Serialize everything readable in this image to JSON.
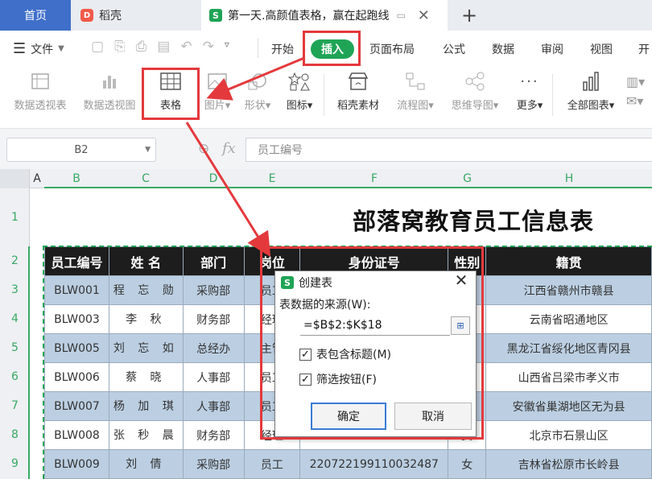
{
  "tabs": {
    "home": "首页",
    "wps": "稻壳",
    "doc": "第一天.高颜值表格，赢在起跑线"
  },
  "menu": {
    "file": "文件",
    "items": [
      "开始",
      "插入",
      "页面布局",
      "公式",
      "数据",
      "审阅",
      "视图",
      "开"
    ]
  },
  "toolbar": [
    "数据透视表",
    "数据透视图",
    "表格",
    "图片",
    "形状",
    "图标",
    "稻壳素材",
    "流程图",
    "思维导图",
    "更多",
    "全部图表"
  ],
  "formula_bar": {
    "cell_ref": "B2",
    "fx": "fx",
    "content": "员工编号"
  },
  "columns": [
    "A",
    "B",
    "C",
    "D",
    "E",
    "F",
    "G",
    "H"
  ],
  "rows": [
    "1",
    "2",
    "3",
    "4",
    "5",
    "6",
    "7",
    "8",
    "9"
  ],
  "sheet_title": "部落窝教育员工信息表",
  "table": {
    "headers": [
      "员工编号",
      "姓 名",
      "部门",
      "岗位",
      "身份证号",
      "性别",
      "籍贯"
    ],
    "rows": [
      [
        "BLW001",
        "程 忘 勋",
        "采购部",
        "员工",
        "",
        "",
        "江西省赣州市赣县"
      ],
      [
        "BLW003",
        "李 秋",
        "财务部",
        "经理",
        "",
        "",
        "云南省昭通地区"
      ],
      [
        "BLW005",
        "刘 忘 如",
        "总经办",
        "主管",
        "",
        "",
        "黑龙江省绥化地区青冈县"
      ],
      [
        "BLW006",
        "蔡 晓",
        "人事部",
        "员工",
        "",
        "",
        "山西省吕梁市孝义市"
      ],
      [
        "BLW007",
        "杨 加 琪",
        "人事部",
        "员工",
        "",
        "",
        "安徽省巢湖地区无为县"
      ],
      [
        "BLW008",
        "张 秒 晨",
        "财务部",
        "经理",
        "110107199008176646",
        "女",
        "北京市石景山区"
      ],
      [
        "BLW009",
        "刘 倩",
        "采购部",
        "员工",
        "220722199110032487",
        "女",
        "吉林省松原市长岭县"
      ]
    ]
  },
  "dialog": {
    "title": "创建表",
    "source_label": "表数据的来源(W):",
    "source_value": "=$B$2:$K$18",
    "has_header_label": "表包含标题(M)",
    "has_header_checked": true,
    "filter_label": "筛选按钮(F)",
    "filter_checked": true,
    "ok": "确定",
    "cancel": "取消"
  },
  "colors": {
    "accent": "#1fa456",
    "highlight": "#e4393c",
    "home_tab": "#3f6fc9",
    "row_band": "#bccfe2"
  }
}
